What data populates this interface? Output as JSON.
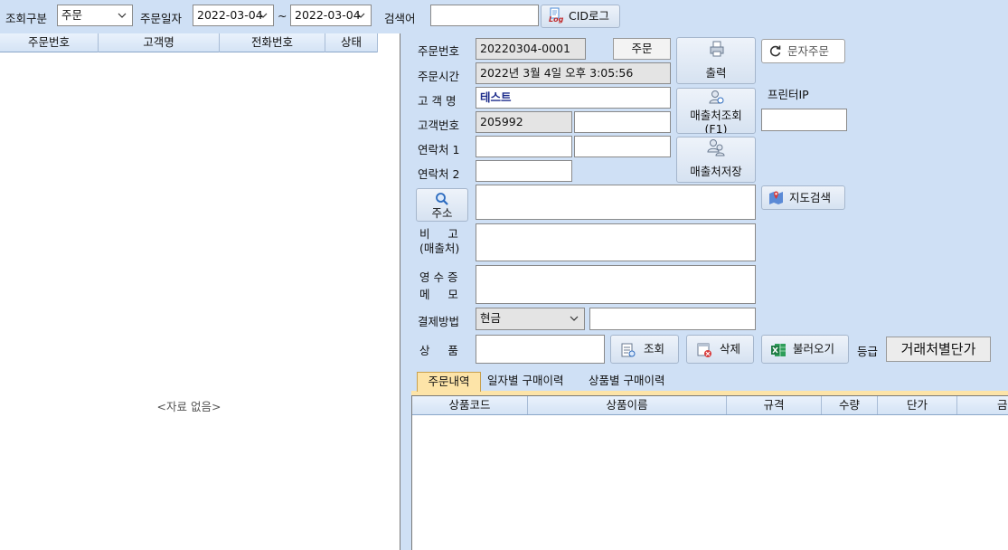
{
  "toolbar": {
    "query_type_label": "조회구분",
    "query_type_value": "주문",
    "order_date_label": "주문일자",
    "date_from": "2022-03-04",
    "date_to": "2022-03-04",
    "range_sep": "~",
    "search_label": "검색어",
    "search_value": "",
    "cid_log_label": "CID로그",
    "cid_log_icon_text": "Log"
  },
  "order_list": {
    "columns": [
      "주문번호",
      "고객명",
      "전화번호",
      "상태"
    ],
    "empty_text": "<자료 없음>"
  },
  "form": {
    "order_no_label": "주문번호",
    "order_no_value": "20220304-0001",
    "order_button": "주문",
    "order_time_label": "주문시간",
    "order_time_value": "2022년 3월 4일 오후 3:05:56",
    "customer_name_label": "고 객 명",
    "customer_name_value": "테스트",
    "customer_no_label": "고객번호",
    "customer_no_value": "205992",
    "customer_no_extra": "",
    "contact1_label": "연락처 1",
    "contact1_a": "",
    "contact1_b": "",
    "contact2_label": "연락처 2",
    "contact2_value": "",
    "address_button": "주소",
    "address_value": "",
    "remark_label_1": "비     고",
    "remark_label_2": "(매출처)",
    "remark_value": "",
    "receipt_label_1": "영 수 증",
    "receipt_label_2": "메     모",
    "receipt_value": "",
    "payment_label": "결제방법",
    "payment_value": "현금",
    "payment_extra": "",
    "product_label": "상     품",
    "product_value": ""
  },
  "actions": {
    "print": "출력",
    "store_lookup_1": "매출처조회",
    "store_lookup_2": "(F1)",
    "store_save": "매출처저장",
    "sms_order": "문자주문",
    "printer_ip_label": "프린터IP",
    "printer_ip_value": "",
    "map_search": "지도검색",
    "lookup": "조회",
    "delete": "삭제",
    "import": "불러오기",
    "grade_label": "등급",
    "grade_value": "거래처별단가"
  },
  "tabs": [
    "주문내역",
    "일자별 구매이력",
    "상품별 구매이력"
  ],
  "items_grid": {
    "columns": [
      "상품코드",
      "상품이름",
      "규격",
      "수량",
      "단가",
      "금"
    ]
  },
  "colors": {
    "background": "#cfe0f5",
    "header_gradient_top": "#eaf2fc",
    "active_tab": "#fde4a8",
    "customer_name_text": "#1a2a8a"
  }
}
